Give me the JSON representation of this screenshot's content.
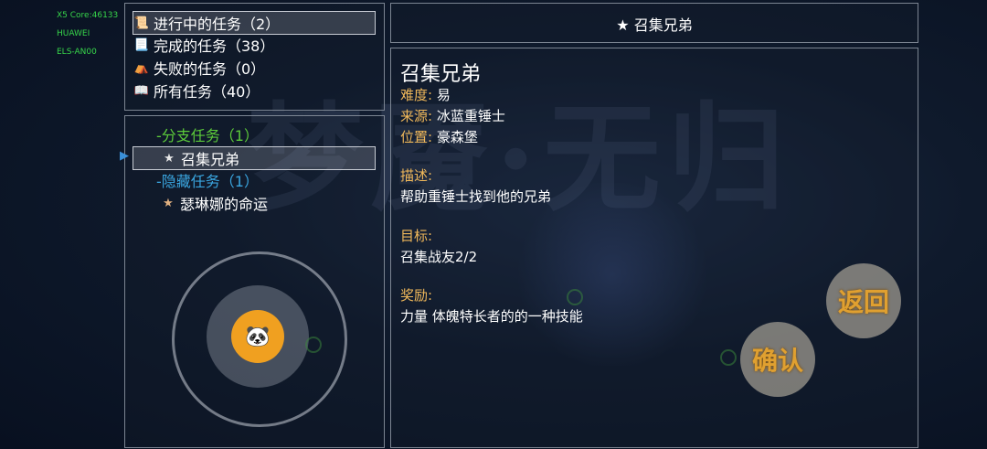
{
  "debug": {
    "core": "X5 Core:46133",
    "vendor": "HUAWEI",
    "model": "ELS-AN00"
  },
  "filters": [
    {
      "icon": "scroll-icon",
      "glyph": "📜",
      "label": "进行中的任务（2）"
    },
    {
      "icon": "rolled-scroll-icon",
      "glyph": "📃",
      "label": "完成的任务（38）"
    },
    {
      "icon": "tent-icon",
      "glyph": "⛺",
      "label": "失败的任务（0）"
    },
    {
      "icon": "book-icon",
      "glyph": "📖",
      "label": "所有任务（40）"
    }
  ],
  "quest_list": {
    "branch_header": "-分支任务（1）",
    "branch_item": "召集兄弟",
    "hidden_header": "-隐藏任务（1）",
    "hidden_item": "瑟琳娜的命运",
    "cursor_glyph": "▶"
  },
  "header_title": "召集兄弟",
  "detail": {
    "title": "召集兄弟",
    "difficulty_label": "难度:",
    "difficulty": "易",
    "source_label": "来源:",
    "source": "冰蓝重锤士",
    "location_label": "位置:",
    "location": "豪森堡",
    "desc_label": "描述:",
    "desc": "帮助重锤士找到他的兄弟",
    "goal_label": "目标:",
    "goal": "召集战友2/2",
    "reward_label": "奖励:",
    "reward": "力量 体魄特长者的的一种技能"
  },
  "buttons": {
    "back": "返回",
    "ok": "确认"
  },
  "background_logo": "梦魇·无归",
  "colors": {
    "label": "#f0b85a",
    "branch": "#5ccb3a",
    "hidden": "#3aa6e0",
    "knob": "#f0a020"
  }
}
